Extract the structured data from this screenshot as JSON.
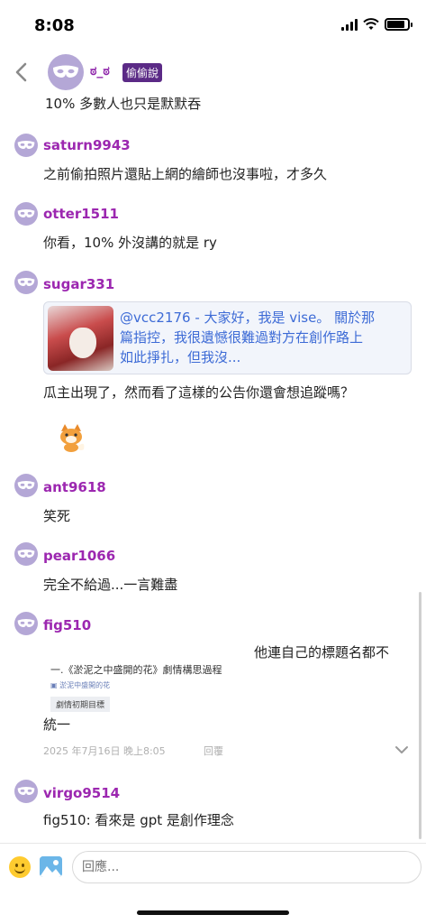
{
  "status_bar": {
    "time": "8:08",
    "battery_level": 0.85
  },
  "header": {
    "author": "ಠ_ಠ",
    "badge": "偷偷說",
    "text": "10% 多數人也只是默默吞"
  },
  "comments": [
    {
      "user": "saturn9943",
      "text": "之前偷拍照片還貼上網的繪師也沒事啦，才多久"
    },
    {
      "user": "otter1511",
      "text": "你看，10% 外沒講的就是 ry"
    },
    {
      "user": "sugar331",
      "quote": {
        "line1": "@vcc2176 - 大家好，我是 vise。  關於那",
        "line2": "篇指控，我很遺憾很難過對方在創作路上",
        "line3": "如此掙扎，但我沒..."
      },
      "text": "瓜主出現了，然而看了這樣的公告你還會想追蹤嗎？",
      "sticker": "fox-sticker"
    },
    {
      "user": "ant9618",
      "text": "笑死"
    },
    {
      "user": "pear1066",
      "text": "完全不給過...一言難盡"
    },
    {
      "user": "fig510",
      "text_right": "他連自己的標題名都不",
      "image": {
        "title": "一.《淤泥之中盛開的花》劇情構思過程",
        "subtitle": "▣ 淤泥中盛開的花",
        "goal": "劇情初期目標"
      },
      "text": "統一",
      "timestamp": "2025 年7月16日 晚上8:05",
      "reply_label": "回覆"
    },
    {
      "user": "virgo9514",
      "text": "fig510: 看來是 gpt 是創作理念"
    }
  ],
  "footer": {
    "placeholder": "回應..."
  },
  "colors": {
    "username": "#9c27b0",
    "badge_bg": "#5b2a86",
    "quote_text": "#3d6bd6",
    "avatar": "#b4a7d6"
  }
}
